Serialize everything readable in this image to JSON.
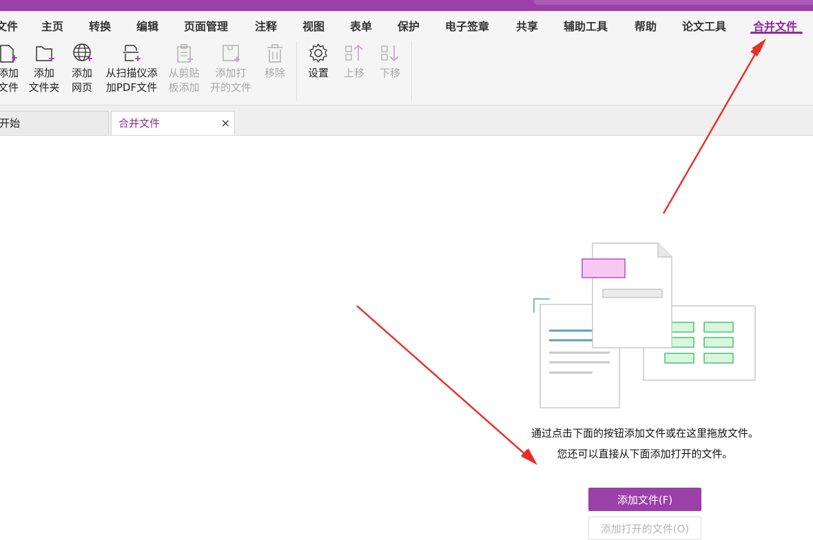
{
  "menu": {
    "items": [
      "文件",
      "主页",
      "转换",
      "编辑",
      "页面管理",
      "注释",
      "视图",
      "表单",
      "保护",
      "电子签章",
      "共享",
      "辅助工具",
      "帮助",
      "论文工具",
      "合并文件"
    ],
    "active": "合并文件"
  },
  "ribbon": {
    "add_files": [
      "添加",
      "文件"
    ],
    "add_folder": [
      "添加",
      "文件夹"
    ],
    "add_webpage": [
      "添加",
      "网页"
    ],
    "add_from_scanner": [
      "从扫描仪添",
      "加PDF文件"
    ],
    "add_from_clipboard": [
      "从剪贴",
      "板添加"
    ],
    "add_open_files": [
      "添加打",
      "开的文件"
    ],
    "remove": "移除",
    "settings": "设置",
    "move_up": "上移",
    "move_down": "下移"
  },
  "tabs": [
    {
      "label": "开始"
    },
    {
      "label": "合并文件",
      "close": "×"
    }
  ],
  "content": {
    "hint_line1": "通过点击下面的按钮添加文件或在这里拖放文件。",
    "hint_line2": "您还可以直接从下面添加打开的文件。",
    "add_files_button": "添加文件(F)",
    "add_open_files_button": "添加打开的文件(O)"
  },
  "colors": {
    "accent": "#9b3fa9",
    "arrow": "#e8302a"
  }
}
